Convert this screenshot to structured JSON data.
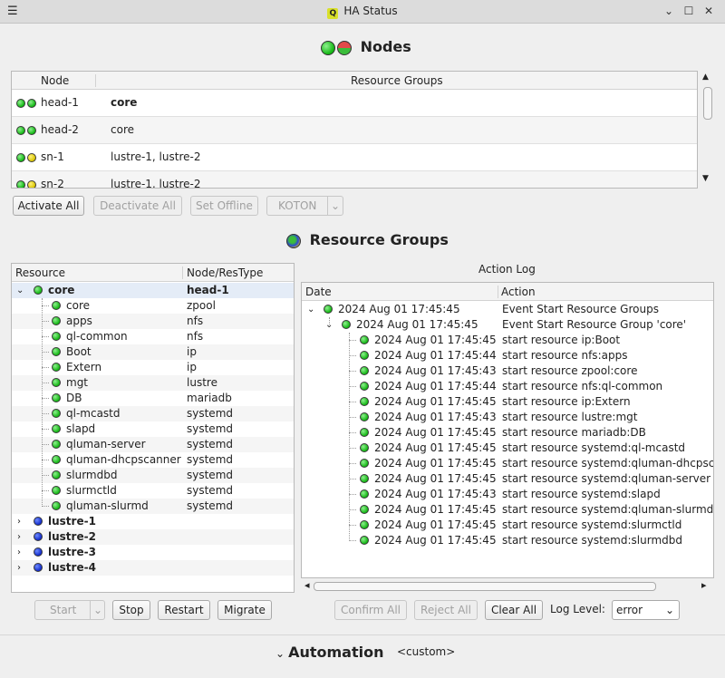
{
  "window": {
    "title": "HA Status"
  },
  "nodes_section": {
    "title": "Nodes",
    "columns": [
      "Node",
      "Resource Groups"
    ],
    "rows": [
      {
        "node": "head-1",
        "groups": "core",
        "dot1": "green",
        "dot2": "green",
        "bold": true
      },
      {
        "node": "head-2",
        "groups": "core",
        "dot1": "green",
        "dot2": "green",
        "bold": false
      },
      {
        "node": "sn-1",
        "groups": "lustre-1, lustre-2",
        "dot1": "green",
        "dot2": "yellow",
        "bold": false
      },
      {
        "node": "sn-2",
        "groups": "lustre-1, lustre-2",
        "dot1": "green",
        "dot2": "yellow",
        "bold": false
      }
    ],
    "buttons": {
      "activate_all": "Activate All",
      "deactivate_all": "Deactivate All",
      "set_offline": "Set Offline",
      "koton": "KOTON"
    }
  },
  "resource_groups_section": {
    "title": "Resource Groups",
    "columns": [
      "Resource",
      "Node/ResType"
    ],
    "root": {
      "name": "core",
      "node": "head-1"
    },
    "children": [
      {
        "name": "core",
        "type": "zpool"
      },
      {
        "name": "apps",
        "type": "nfs"
      },
      {
        "name": "ql-common",
        "type": "nfs"
      },
      {
        "name": "Boot",
        "type": "ip"
      },
      {
        "name": "Extern",
        "type": "ip"
      },
      {
        "name": "mgt",
        "type": "lustre"
      },
      {
        "name": "DB",
        "type": "mariadb"
      },
      {
        "name": "ql-mcastd",
        "type": "systemd"
      },
      {
        "name": "slapd",
        "type": "systemd"
      },
      {
        "name": "qluman-server",
        "type": "systemd"
      },
      {
        "name": "qluman-dhcpscanner",
        "type": "systemd"
      },
      {
        "name": "slurmdbd",
        "type": "systemd"
      },
      {
        "name": "slurmctld",
        "type": "systemd"
      },
      {
        "name": "qluman-slurmd",
        "type": "systemd"
      }
    ],
    "collapsed": [
      "lustre-1",
      "lustre-2",
      "lustre-3",
      "lustre-4"
    ],
    "buttons": {
      "start": "Start",
      "stop": "Stop",
      "restart": "Restart",
      "migrate": "Migrate"
    }
  },
  "action_log": {
    "title": "Action Log",
    "columns": [
      "Date",
      "Action"
    ],
    "root": {
      "date": "2024 Aug 01 17:45:45",
      "action": "Event Start Resource Groups"
    },
    "group": {
      "date": "2024 Aug 01 17:45:45",
      "action": "Event Start Resource Group 'core'"
    },
    "entries": [
      {
        "date": "2024 Aug 01 17:45:45",
        "action": "start resource ip:Boot"
      },
      {
        "date": "2024 Aug 01 17:45:44",
        "action": "start resource nfs:apps"
      },
      {
        "date": "2024 Aug 01 17:45:43",
        "action": "start resource zpool:core"
      },
      {
        "date": "2024 Aug 01 17:45:44",
        "action": "start resource nfs:ql-common"
      },
      {
        "date": "2024 Aug 01 17:45:45",
        "action": "start resource ip:Extern"
      },
      {
        "date": "2024 Aug 01 17:45:43",
        "action": "start resource lustre:mgt"
      },
      {
        "date": "2024 Aug 01 17:45:45",
        "action": "start resource mariadb:DB"
      },
      {
        "date": "2024 Aug 01 17:45:45",
        "action": "start resource systemd:ql-mcastd"
      },
      {
        "date": "2024 Aug 01 17:45:45",
        "action": "start resource systemd:qluman-dhcpsc"
      },
      {
        "date": "2024 Aug 01 17:45:45",
        "action": "start resource systemd:qluman-server"
      },
      {
        "date": "2024 Aug 01 17:45:43",
        "action": "start resource systemd:slapd"
      },
      {
        "date": "2024 Aug 01 17:45:45",
        "action": "start resource systemd:qluman-slurmd"
      },
      {
        "date": "2024 Aug 01 17:45:45",
        "action": "start resource systemd:slurmctld"
      },
      {
        "date": "2024 Aug 01 17:45:45",
        "action": "start resource systemd:slurmdbd"
      }
    ],
    "buttons": {
      "confirm_all": "Confirm All",
      "reject_all": "Reject All",
      "clear_all": "Clear All"
    },
    "log_level_label": "Log Level:",
    "log_level_value": "error"
  },
  "automation": {
    "title": "Automation",
    "value": "<custom>"
  },
  "colors": {
    "green": "#12b612",
    "yellow": "#d9c400",
    "blue": "#1029c9",
    "selection": "#e4ecf7"
  }
}
